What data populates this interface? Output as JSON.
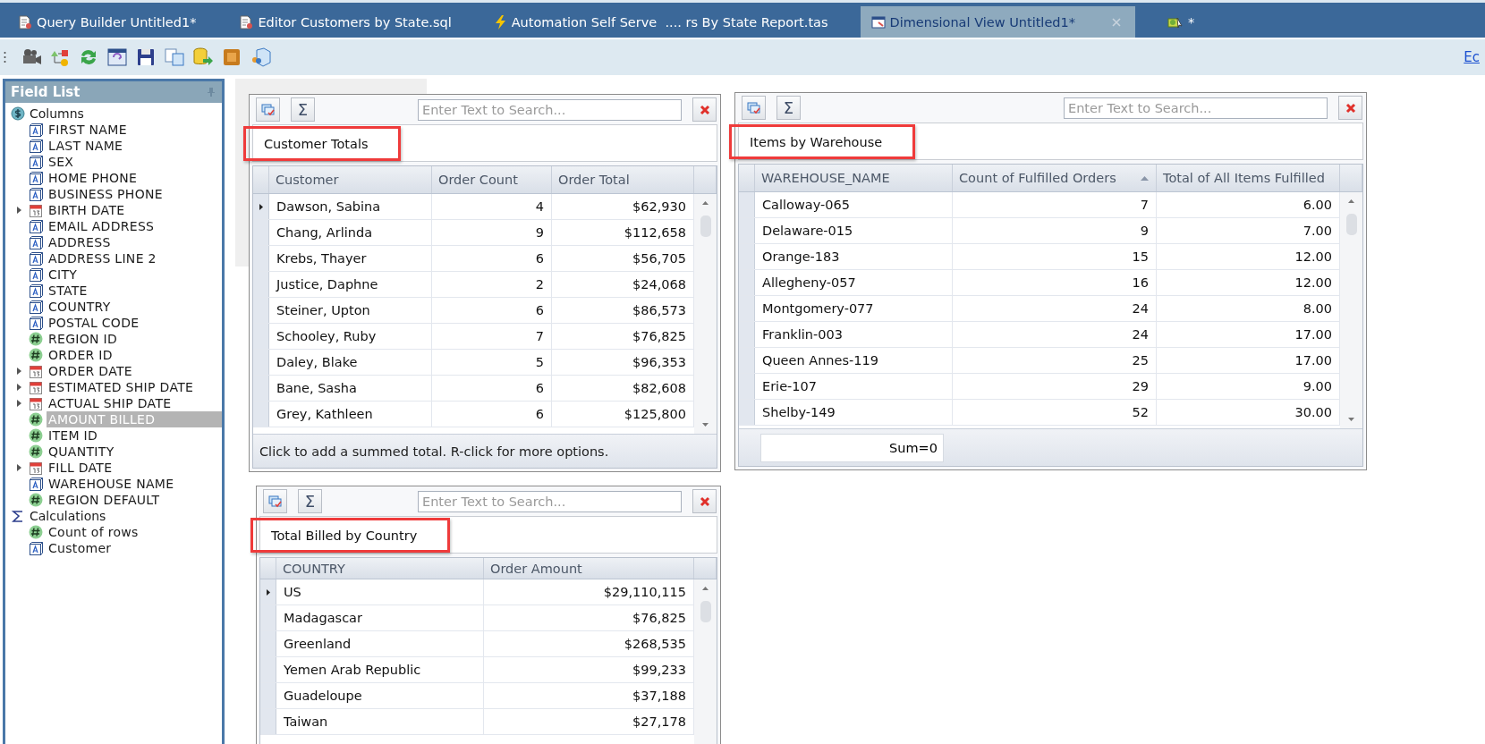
{
  "tabs": [
    {
      "label": "Query Builder Untitled1*",
      "kind": "query",
      "selected": false
    },
    {
      "label": "Editor Customers by State.sql",
      "kind": "editor",
      "selected": false
    },
    {
      "label": "Automation Self Serve  .... rs By State Report.tas",
      "kind": "automation",
      "selected": false
    },
    {
      "label": "Dimensional View Untitled1*",
      "kind": "dimensional",
      "selected": true
    },
    {
      "label": "*",
      "kind": "wizard",
      "selected": false
    }
  ],
  "toolbar": {
    "link": "Ec"
  },
  "field_list": {
    "title": "Field List",
    "groups": [
      {
        "label": "Columns",
        "kind": "columns",
        "children": [
          {
            "label": "FIRST NAME",
            "kind": "text",
            "selected": false
          },
          {
            "label": "LAST NAME",
            "kind": "text",
            "selected": false
          },
          {
            "label": "SEX",
            "kind": "text",
            "selected": false
          },
          {
            "label": "HOME PHONE",
            "kind": "text",
            "selected": false
          },
          {
            "label": "BUSINESS PHONE",
            "kind": "text",
            "selected": false
          },
          {
            "label": "BIRTH DATE",
            "kind": "date",
            "selected": false
          },
          {
            "label": "EMAIL ADDRESS",
            "kind": "text",
            "selected": false
          },
          {
            "label": "ADDRESS",
            "kind": "text",
            "selected": false
          },
          {
            "label": "ADDRESS LINE 2",
            "kind": "text",
            "selected": false
          },
          {
            "label": "CITY",
            "kind": "text",
            "selected": false
          },
          {
            "label": "STATE",
            "kind": "text",
            "selected": false
          },
          {
            "label": "COUNTRY",
            "kind": "text",
            "selected": false
          },
          {
            "label": "POSTAL CODE",
            "kind": "text",
            "selected": false
          },
          {
            "label": "REGION ID",
            "kind": "number",
            "selected": false
          },
          {
            "label": "ORDER ID",
            "kind": "number",
            "selected": false
          },
          {
            "label": "ORDER DATE",
            "kind": "date",
            "selected": false
          },
          {
            "label": "ESTIMATED SHIP DATE",
            "kind": "date",
            "selected": false
          },
          {
            "label": "ACTUAL SHIP DATE",
            "kind": "date",
            "selected": false
          },
          {
            "label": "AMOUNT BILLED",
            "kind": "number",
            "selected": true
          },
          {
            "label": "ITEM ID",
            "kind": "number",
            "selected": false
          },
          {
            "label": "QUANTITY",
            "kind": "number",
            "selected": false
          },
          {
            "label": "FILL DATE",
            "kind": "date",
            "selected": false
          },
          {
            "label": "WAREHOUSE NAME",
            "kind": "text",
            "selected": false
          },
          {
            "label": "REGION DEFAULT",
            "kind": "number",
            "selected": false
          }
        ]
      },
      {
        "label": "Calculations",
        "kind": "calculations",
        "children": [
          {
            "label": "Count of rows",
            "kind": "number",
            "selected": false
          },
          {
            "label": "Customer",
            "kind": "text",
            "selected": false
          }
        ]
      }
    ]
  },
  "panels": [
    {
      "title": "Customer Totals",
      "highlighted": true,
      "sum_button": "Σ",
      "search": {
        "placeholder": "Enter Text to Search..."
      },
      "columns": [
        {
          "label": "Customer",
          "kind": "text",
          "sorted": false
        },
        {
          "label": "Order Count",
          "kind": "number",
          "sorted": false
        },
        {
          "label": "Order Total",
          "kind": "number",
          "sorted": false
        }
      ],
      "rows": [
        {
          "cells": [
            "Dawson, Sabina",
            "4",
            "$62,930"
          ],
          "selected": true
        },
        {
          "cells": [
            "Chang, Arlinda",
            "9",
            "$112,658"
          ],
          "selected": false
        },
        {
          "cells": [
            "Krebs, Thayer",
            "6",
            "$56,705"
          ],
          "selected": false
        },
        {
          "cells": [
            "Justice, Daphne",
            "2",
            "$24,068"
          ],
          "selected": false
        },
        {
          "cells": [
            "Steiner, Upton",
            "6",
            "$86,573"
          ],
          "selected": false
        },
        {
          "cells": [
            "Schooley, Ruby",
            "7",
            "$76,825"
          ],
          "selected": false
        },
        {
          "cells": [
            "Daley, Blake",
            "5",
            "$96,353"
          ],
          "selected": false
        },
        {
          "cells": [
            "Bane, Sasha",
            "6",
            "$82,608"
          ],
          "selected": false
        },
        {
          "cells": [
            "Grey, Kathleen",
            "6",
            "$125,800"
          ],
          "selected": false
        }
      ],
      "footer": {
        "kind": "hint",
        "text": "Click to add a summed total. R-click for more options."
      }
    },
    {
      "title": "Items by Warehouse",
      "highlighted": true,
      "sum_button": "Σ",
      "search": {
        "placeholder": "Enter Text to Search..."
      },
      "columns": [
        {
          "label": "WAREHOUSE_NAME",
          "kind": "text",
          "sorted": false
        },
        {
          "label": "Count of Fulfilled Orders",
          "kind": "number",
          "sorted": true
        },
        {
          "label": "Total of All Items Fulfilled",
          "kind": "number",
          "sorted": false
        }
      ],
      "rows": [
        {
          "cells": [
            "Calloway-065",
            "7",
            "6.00"
          ],
          "selected": false
        },
        {
          "cells": [
            "Delaware-015",
            "9",
            "7.00"
          ],
          "selected": false
        },
        {
          "cells": [
            "Orange-183",
            "15",
            "12.00"
          ],
          "selected": false
        },
        {
          "cells": [
            "Allegheny-057",
            "16",
            "12.00"
          ],
          "selected": false
        },
        {
          "cells": [
            "Montgomery-077",
            "24",
            "8.00"
          ],
          "selected": false
        },
        {
          "cells": [
            "Franklin-003",
            "24",
            "17.00"
          ],
          "selected": false
        },
        {
          "cells": [
            "Queen Annes-119",
            "25",
            "17.00"
          ],
          "selected": false
        },
        {
          "cells": [
            "Erie-107",
            "29",
            "9.00"
          ],
          "selected": false
        },
        {
          "cells": [
            "Shelby-149",
            "52",
            "30.00"
          ],
          "selected": false
        }
      ],
      "footer": {
        "kind": "sum",
        "text": "Sum=0"
      }
    },
    {
      "title": "Total Billed by Country",
      "highlighted": true,
      "sum_button": "Σ",
      "search": {
        "placeholder": "Enter Text to Search..."
      },
      "columns": [
        {
          "label": "COUNTRY",
          "kind": "text",
          "sorted": false
        },
        {
          "label": "Order Amount",
          "kind": "number",
          "sorted": false
        }
      ],
      "rows": [
        {
          "cells": [
            "US",
            "$29,110,115"
          ],
          "selected": true
        },
        {
          "cells": [
            "Madagascar",
            "$76,825"
          ],
          "selected": false
        },
        {
          "cells": [
            "Greenland",
            "$268,535"
          ],
          "selected": false
        },
        {
          "cells": [
            "Yemen Arab Republic",
            "$99,233"
          ],
          "selected": false
        },
        {
          "cells": [
            "Guadeloupe",
            "$37,188"
          ],
          "selected": false
        },
        {
          "cells": [
            "Taiwan",
            "$27,178"
          ],
          "selected": false
        }
      ]
    }
  ]
}
